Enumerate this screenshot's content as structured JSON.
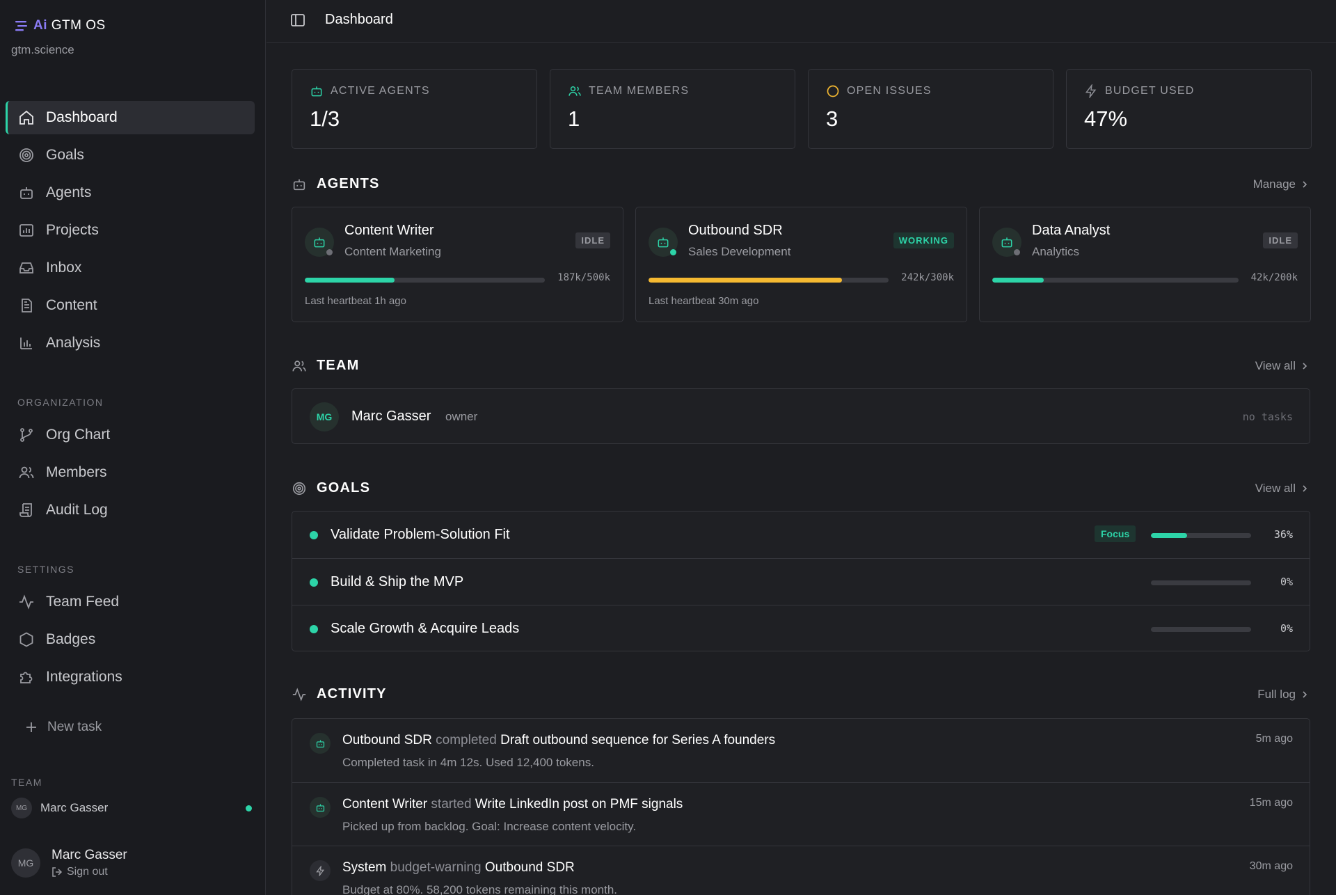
{
  "sidebar": {
    "brand": {
      "ai": "Ai",
      "name": "GTM OS"
    },
    "workspace": "gtm.science",
    "nav_main": [
      {
        "label": "Dashboard",
        "icon": "home-icon",
        "active": true
      },
      {
        "label": "Goals",
        "icon": "target-icon"
      },
      {
        "label": "Agents",
        "icon": "bot-icon"
      },
      {
        "label": "Projects",
        "icon": "chart-folder-icon"
      },
      {
        "label": "Inbox",
        "icon": "inbox-icon"
      },
      {
        "label": "Content",
        "icon": "document-icon"
      },
      {
        "label": "Analysis",
        "icon": "bar-chart-icon"
      }
    ],
    "org_label": "ORGANIZATION",
    "nav_org": [
      {
        "label": "Org Chart",
        "icon": "branch-icon"
      },
      {
        "label": "Members",
        "icon": "users-icon"
      },
      {
        "label": "Audit Log",
        "icon": "scroll-icon"
      }
    ],
    "settings_label": "SETTINGS",
    "nav_settings": [
      {
        "label": "Team Feed",
        "icon": "activity-icon"
      },
      {
        "label": "Badges",
        "icon": "hexagon-icon"
      },
      {
        "label": "Integrations",
        "icon": "puzzle-icon"
      }
    ],
    "new_task": "New task",
    "team_label": "TEAM",
    "team_member": {
      "initials": "MG",
      "name": "Marc Gasser"
    },
    "user": {
      "initials": "MG",
      "name": "Marc Gasser",
      "sign_out": "Sign out"
    }
  },
  "topbar": {
    "title": "Dashboard"
  },
  "stats": [
    {
      "label": "ACTIVE AGENTS",
      "value": "1/3",
      "icon": "bot-icon",
      "color": "#2dd4a8"
    },
    {
      "label": "TEAM MEMBERS",
      "value": "1",
      "icon": "users-icon",
      "color": "#2dd4a8"
    },
    {
      "label": "OPEN ISSUES",
      "value": "3",
      "icon": "circle-icon",
      "color": "#f5b931"
    },
    {
      "label": "BUDGET USED",
      "value": "47%",
      "icon": "bolt-icon",
      "color": "#8d8e95"
    }
  ],
  "agents_section": {
    "title": "AGENTS",
    "link": "Manage"
  },
  "agents": [
    {
      "name": "Content Writer",
      "role": "Content Marketing",
      "status": "IDLE",
      "usage": 0.374,
      "usage_label": "187k/500k",
      "bar_color": "#2dd4a8",
      "heartbeat": "Last heartbeat 1h ago"
    },
    {
      "name": "Outbound SDR",
      "role": "Sales Development",
      "status": "WORKING",
      "usage": 0.807,
      "usage_label": "242k/300k",
      "bar_color": "#f5b931",
      "heartbeat": "Last heartbeat 30m ago"
    },
    {
      "name": "Data Analyst",
      "role": "Analytics",
      "status": "IDLE",
      "usage": 0.21,
      "usage_label": "42k/200k",
      "bar_color": "#2dd4a8",
      "heartbeat": ""
    }
  ],
  "team_section": {
    "title": "TEAM",
    "link": "View all"
  },
  "team": [
    {
      "initials": "MG",
      "name": "Marc Gasser",
      "role": "owner",
      "tasks": "no tasks"
    }
  ],
  "goals_section": {
    "title": "GOALS",
    "link": "View all"
  },
  "goals": [
    {
      "title": "Validate Problem-Solution Fit",
      "focus": "Focus",
      "progress": 0.36,
      "pct": "36%"
    },
    {
      "title": "Build & Ship the MVP",
      "focus": "",
      "progress": 0,
      "pct": "0%"
    },
    {
      "title": "Scale Growth & Acquire Leads",
      "focus": "",
      "progress": 0,
      "pct": "0%"
    }
  ],
  "activity_section": {
    "title": "ACTIVITY",
    "link": "Full log"
  },
  "activity": [
    {
      "actor": "Outbound SDR",
      "verb": "completed",
      "target": "Draft outbound sequence for Series A founders",
      "detail": "Completed task in 4m 12s. Used 12,400 tokens.",
      "time": "5m ago",
      "icon": "bot-icon"
    },
    {
      "actor": "Content Writer",
      "verb": "started",
      "target": "Write LinkedIn post on PMF signals",
      "detail": "Picked up from backlog. Goal: Increase content velocity.",
      "time": "15m ago",
      "icon": "bot-icon"
    },
    {
      "actor": "System",
      "verb": "budget-warning",
      "target": "Outbound SDR",
      "detail": "Budget at 80%. 58,200 tokens remaining this month.",
      "time": "30m ago",
      "icon": "bolt-icon"
    }
  ],
  "colors": {
    "accent": "#2dd4a8",
    "warning": "#f5b931",
    "brand_ai": "#8b7cf6"
  }
}
